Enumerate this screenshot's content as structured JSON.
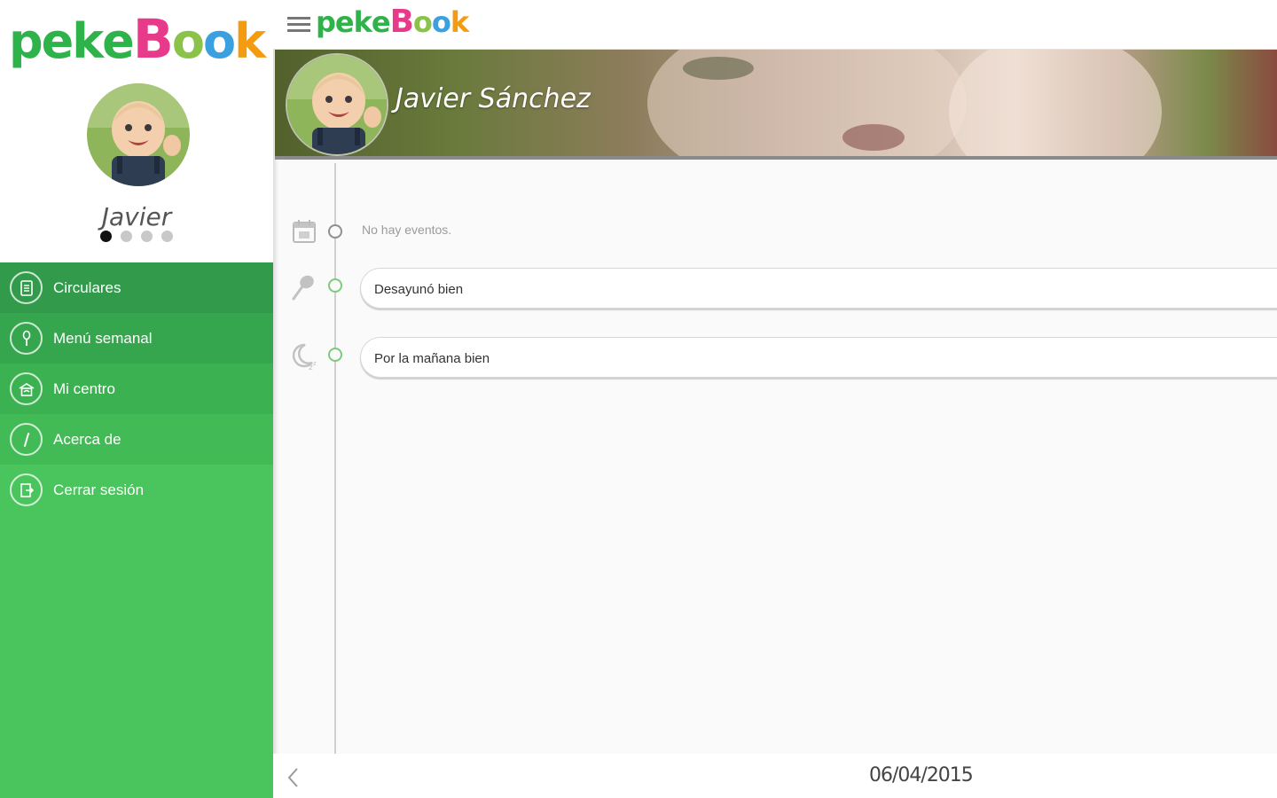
{
  "app": {
    "logo_letters": [
      {
        "ch": "p",
        "color": "#2eb24a"
      },
      {
        "ch": "e",
        "color": "#2eb24a"
      },
      {
        "ch": "k",
        "color": "#2eb24a"
      },
      {
        "ch": "e",
        "color": "#2eb24a"
      },
      {
        "ch": "B",
        "color": "#e83a8a"
      },
      {
        "ch": "o",
        "color": "#8bc34a"
      },
      {
        "ch": "o",
        "color": "#3aa0e0"
      },
      {
        "ch": "k",
        "color": "#f39c12"
      }
    ]
  },
  "sidebar": {
    "child_name": "Javier",
    "children_count": 4,
    "active_child_index": 0,
    "menu": [
      {
        "label": "Circulares",
        "icon": "document-icon"
      },
      {
        "label": "Menú semanal",
        "icon": "spoon-icon"
      },
      {
        "label": "Mi centro",
        "icon": "school-icon"
      },
      {
        "label": "Acerca de",
        "icon": "info-icon"
      },
      {
        "label": "Cerrar sesión",
        "icon": "logout-icon"
      }
    ]
  },
  "header": {
    "child_full_name": "Javier Sánchez"
  },
  "timeline": {
    "events_text": "No hay eventos.",
    "entries": [
      {
        "text": "Desayunó bien",
        "icon": "spoon-icon"
      },
      {
        "text": "Por la mañana bien",
        "icon": "moon-sleep-icon"
      }
    ]
  },
  "footer": {
    "date": "06/04/2015"
  }
}
